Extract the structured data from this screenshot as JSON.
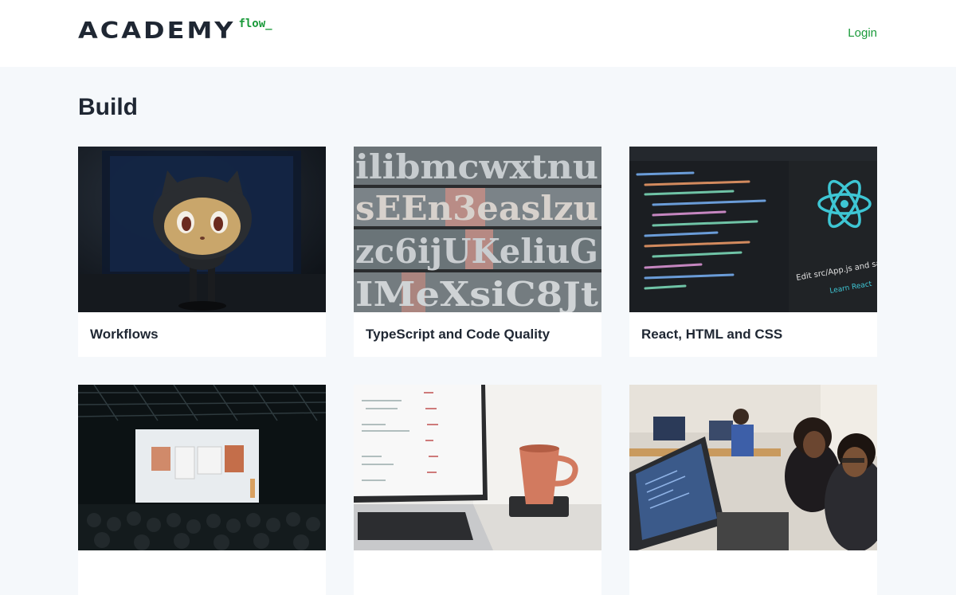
{
  "header": {
    "logo_main": "ACADEMY",
    "logo_sub": "flow_",
    "login_label": "Login"
  },
  "main": {
    "section_title": "Build",
    "cards": [
      {
        "title": "Workflows",
        "image": "octocat-figurine-photo"
      },
      {
        "title": "TypeScript and Code Quality",
        "image": "letterpress-type-photo"
      },
      {
        "title": "React, HTML and CSS",
        "image": "react-code-screen-photo"
      },
      {
        "title": "",
        "image": "conference-presentation-photo"
      },
      {
        "title": "",
        "image": "laptop-coffee-cup-photo"
      },
      {
        "title": "",
        "image": "people-coding-photo"
      }
    ]
  },
  "colors": {
    "accent": "#1a9a3a",
    "text": "#1f2733",
    "background": "#f5f8fb"
  }
}
